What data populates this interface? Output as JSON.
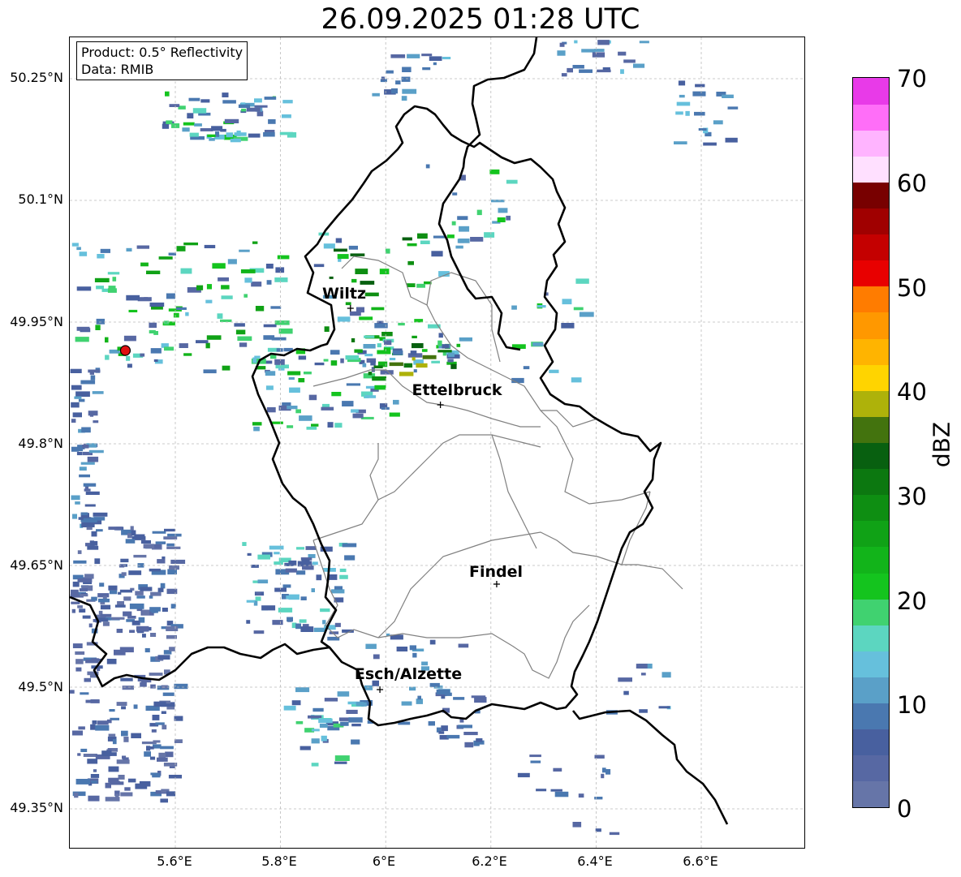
{
  "title": "26.09.2025 01:28 UTC",
  "infobox": {
    "product": "Product: 0.5° Reflectivity",
    "source": "Data: RMIB"
  },
  "axes": {
    "lat_labels": [
      "50.25°N",
      "50.1°N",
      "49.95°N",
      "49.8°N",
      "49.65°N",
      "49.5°N",
      "49.35°N"
    ],
    "lon_labels": [
      "5.6°E",
      "5.8°E",
      "6°E",
      "6.2°E",
      "6.4°E",
      "6.6°E"
    ]
  },
  "cities": [
    {
      "name": "Wiltz",
      "lat": 49.967,
      "lon": 5.933
    },
    {
      "name": "Ettelbruck",
      "lat": 49.848,
      "lon": 6.104
    },
    {
      "name": "Findel",
      "lat": 49.627,
      "lon": 6.211
    },
    {
      "name": "Esch/Alzette",
      "lat": 49.497,
      "lon": 5.989
    }
  ],
  "radar_site": {
    "lat": 49.915,
    "lon": 5.505,
    "color": "#e01010"
  },
  "colorbar": {
    "label": "dBZ",
    "ticks": [
      "0",
      "10",
      "20",
      "30",
      "40",
      "50",
      "60",
      "70"
    ],
    "colors": [
      "#6675a8",
      "#5768a3",
      "#48609f",
      "#4a78b0",
      "#5aa0c8",
      "#66c0dc",
      "#5cd6c0",
      "#40d270",
      "#14c41e",
      "#12b41a",
      "#10a216",
      "#0e8e12",
      "#0c7810",
      "#086010",
      "#43730e",
      "#aeb20a",
      "#ffd400",
      "#ffb400",
      "#ff9800",
      "#ff7c00",
      "#e80000",
      "#c40000",
      "#a00000",
      "#780000",
      "#ffe0ff",
      "#ffb4ff",
      "#ff6ef8",
      "#e83ae8"
    ]
  },
  "legend_colors": {
    "border": "#000000",
    "districts": "#808080",
    "grid": "#bbbbbb"
  }
}
